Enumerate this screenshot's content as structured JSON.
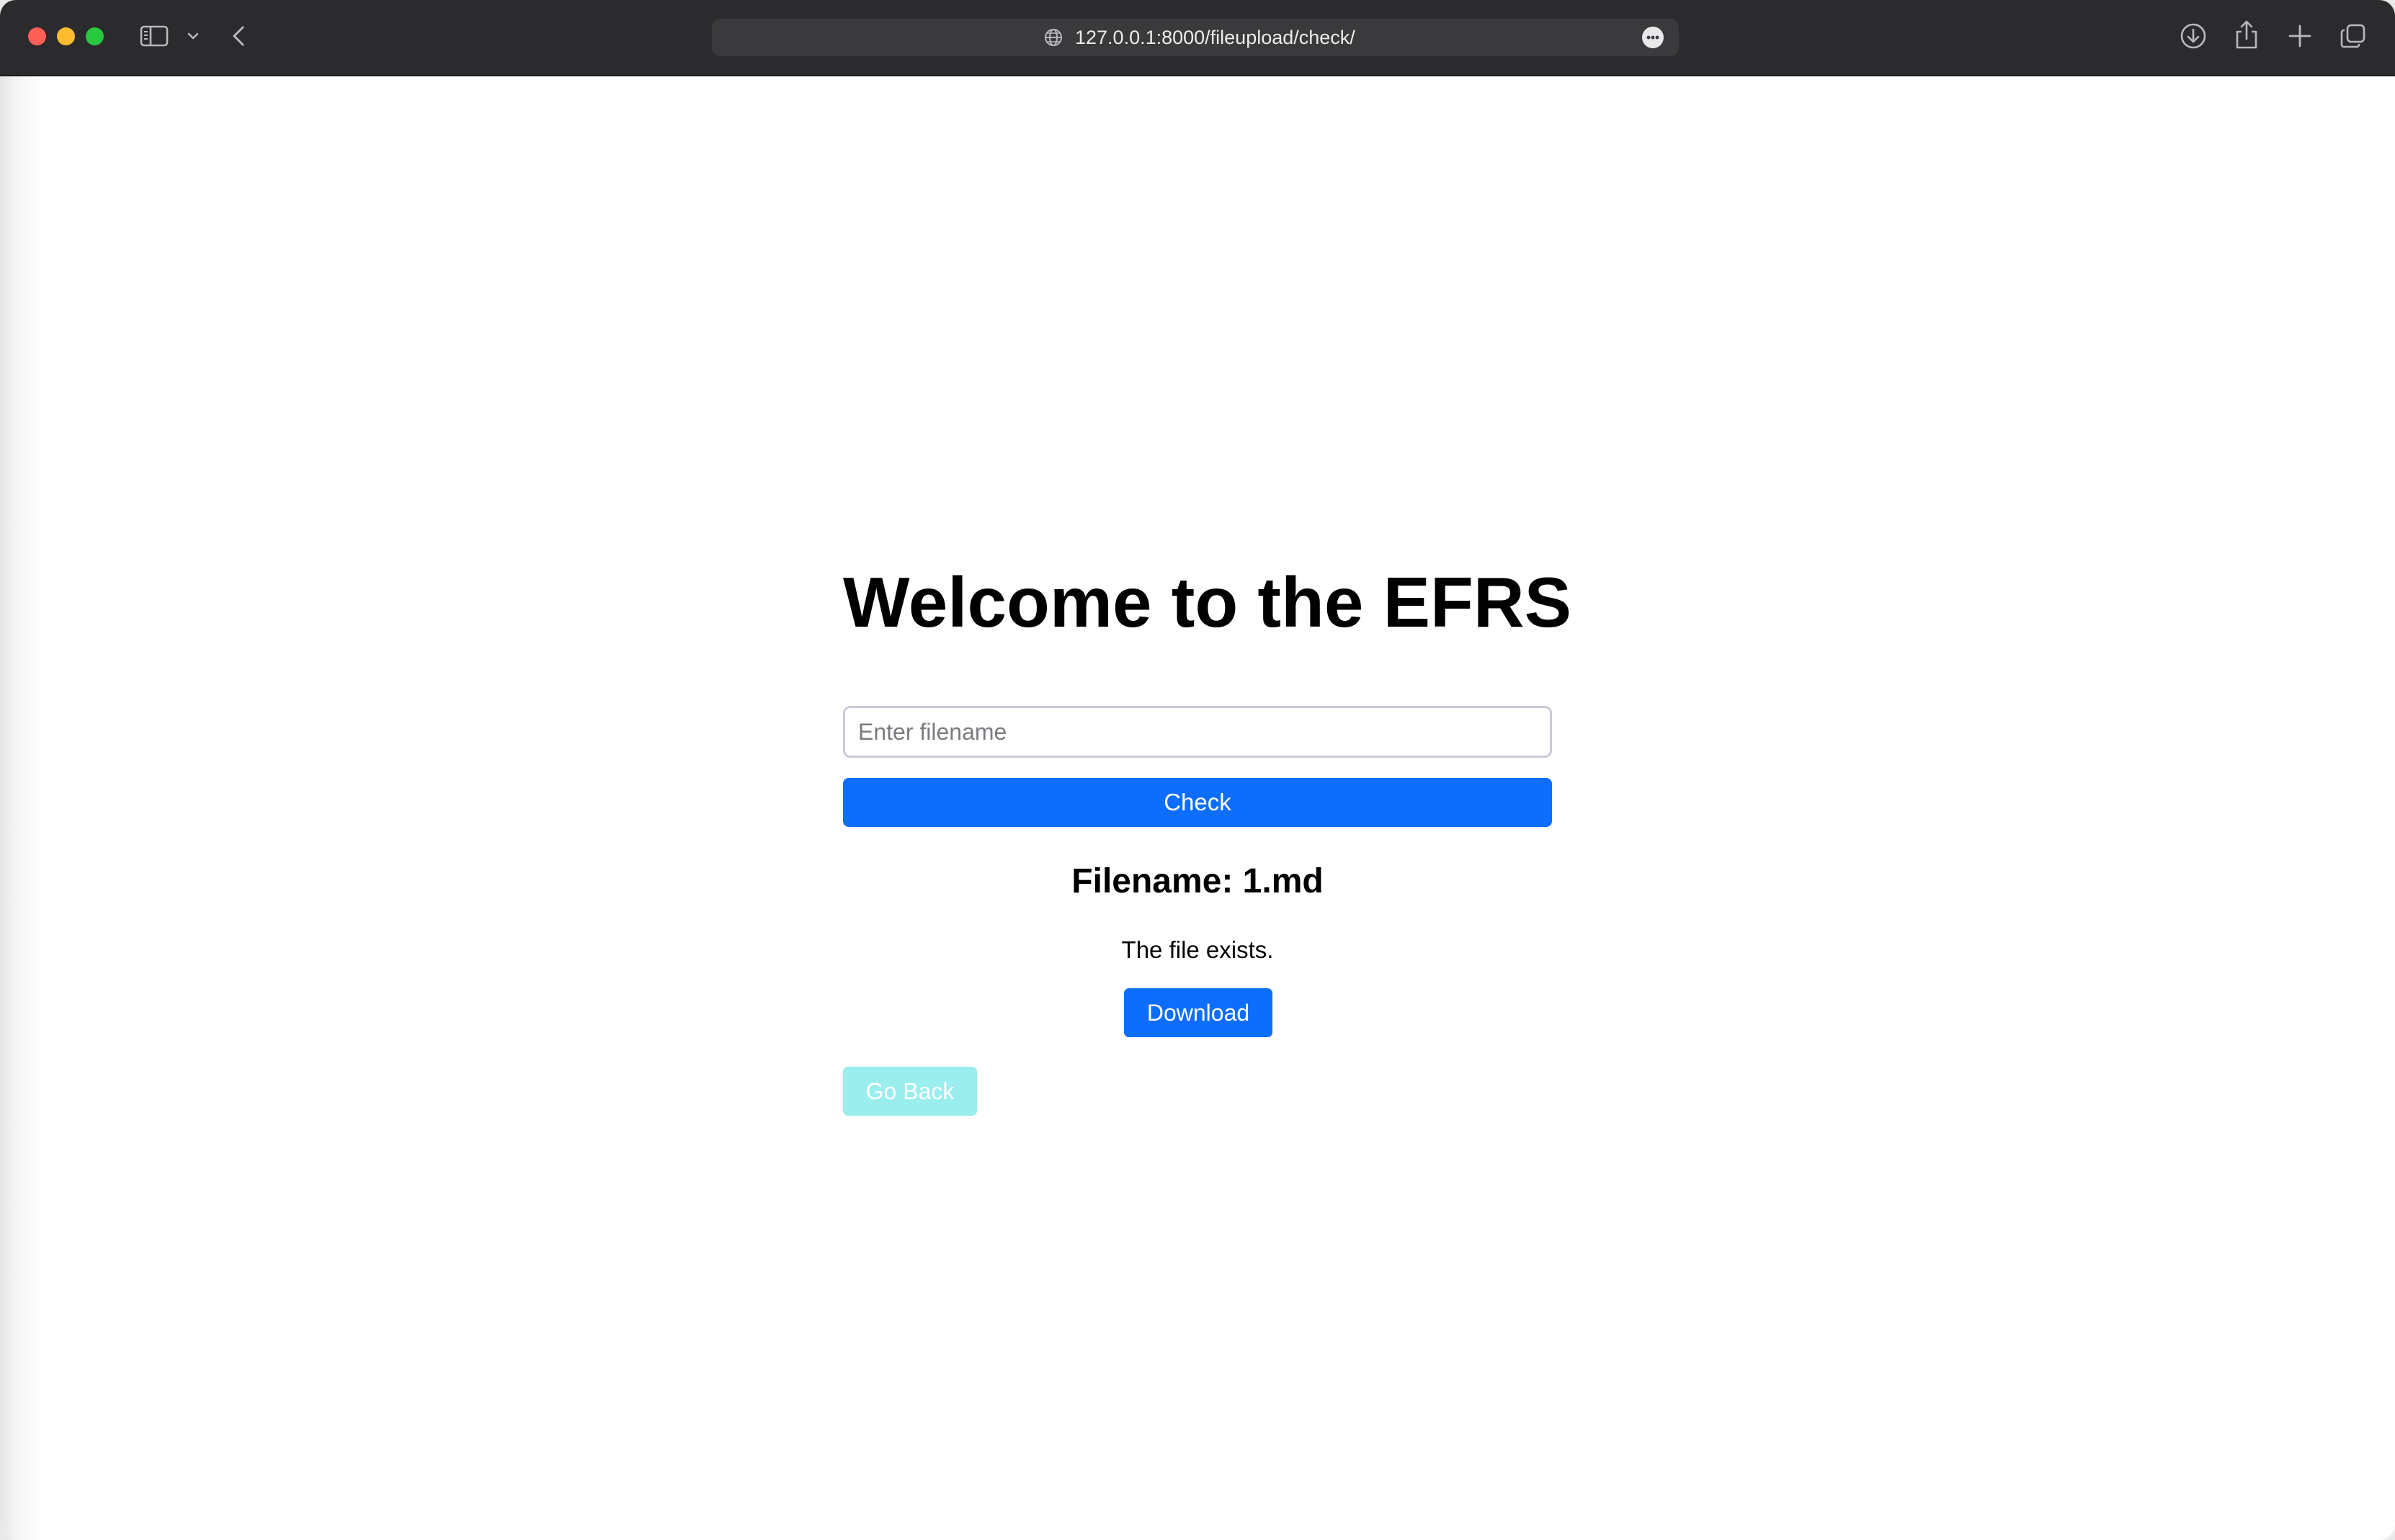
{
  "browser": {
    "url": "127.0.0.1:8000/fileupload/check/",
    "icons": {
      "sidebar": "sidebar-icon",
      "sidebar_menu": "chevron-down-icon",
      "back": "chevron-left-icon",
      "site": "globe-icon",
      "page_menu": "more-icon",
      "downloads": "download-icon",
      "share": "share-icon",
      "new_tab": "plus-icon",
      "tab_overview": "tabs-icon"
    }
  },
  "page": {
    "title": "Welcome to the EFRS",
    "input": {
      "placeholder": "Enter filename",
      "value": ""
    },
    "check_label": "Check",
    "result": {
      "heading": "Filename: 1.md",
      "status": "The file exists.",
      "download_label": "Download"
    },
    "back_label": "Go Back"
  },
  "colors": {
    "primary": "#0d6efd",
    "info_disabled": "#9beeee",
    "toolbar": "#2b2b2d"
  }
}
